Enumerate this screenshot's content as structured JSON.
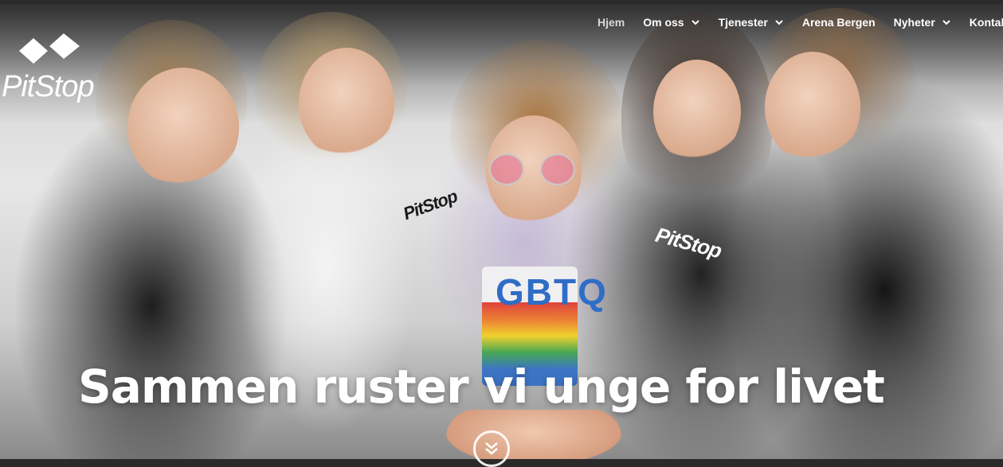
{
  "brand": {
    "name": "PitStop",
    "icon": "diamond-pair-logo-icon"
  },
  "nav": {
    "items": [
      {
        "label": "Hjem",
        "active": true,
        "dropdown": false
      },
      {
        "label": "Om oss",
        "active": false,
        "dropdown": true
      },
      {
        "label": "Tjenester",
        "active": false,
        "dropdown": true
      },
      {
        "label": "Arena Bergen",
        "active": false,
        "dropdown": false
      },
      {
        "label": "Nyheter",
        "active": false,
        "dropdown": true
      },
      {
        "label": "Kontakt",
        "active": false,
        "dropdown": false
      }
    ]
  },
  "hero": {
    "headline": "Sammen ruster vi unge for livet",
    "shirt_text": "GBTQ",
    "hoodie_brand": "PitStop",
    "scroll_icon": "double-chevron-down-icon"
  },
  "colors": {
    "nav_text": "#ffffff",
    "headline": "#ffffff"
  }
}
